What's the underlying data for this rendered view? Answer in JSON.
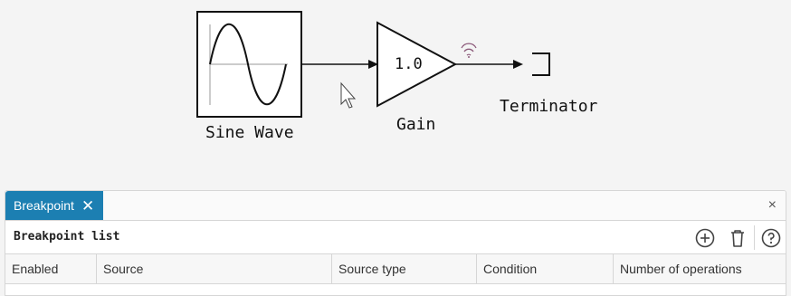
{
  "diagram": {
    "blocks": [
      {
        "id": "sine",
        "label": "Sine Wave"
      },
      {
        "id": "gain",
        "label": "Gain",
        "value": "1.0"
      },
      {
        "id": "term",
        "label": "Terminator"
      }
    ],
    "icons": [
      "signal-wifi-icon",
      "mouse-cursor-icon"
    ]
  },
  "panel": {
    "tab_label": "Breakpoint",
    "tab_close_glyph": "✕",
    "panel_close_glyph": "×",
    "toolbar_title": "Breakpoint list",
    "toolbar_icons": [
      "add-icon",
      "trash-icon",
      "help-icon"
    ],
    "columns": [
      "Enabled",
      "Source",
      "Source type",
      "Condition",
      "Number of operations"
    ],
    "rows": []
  }
}
